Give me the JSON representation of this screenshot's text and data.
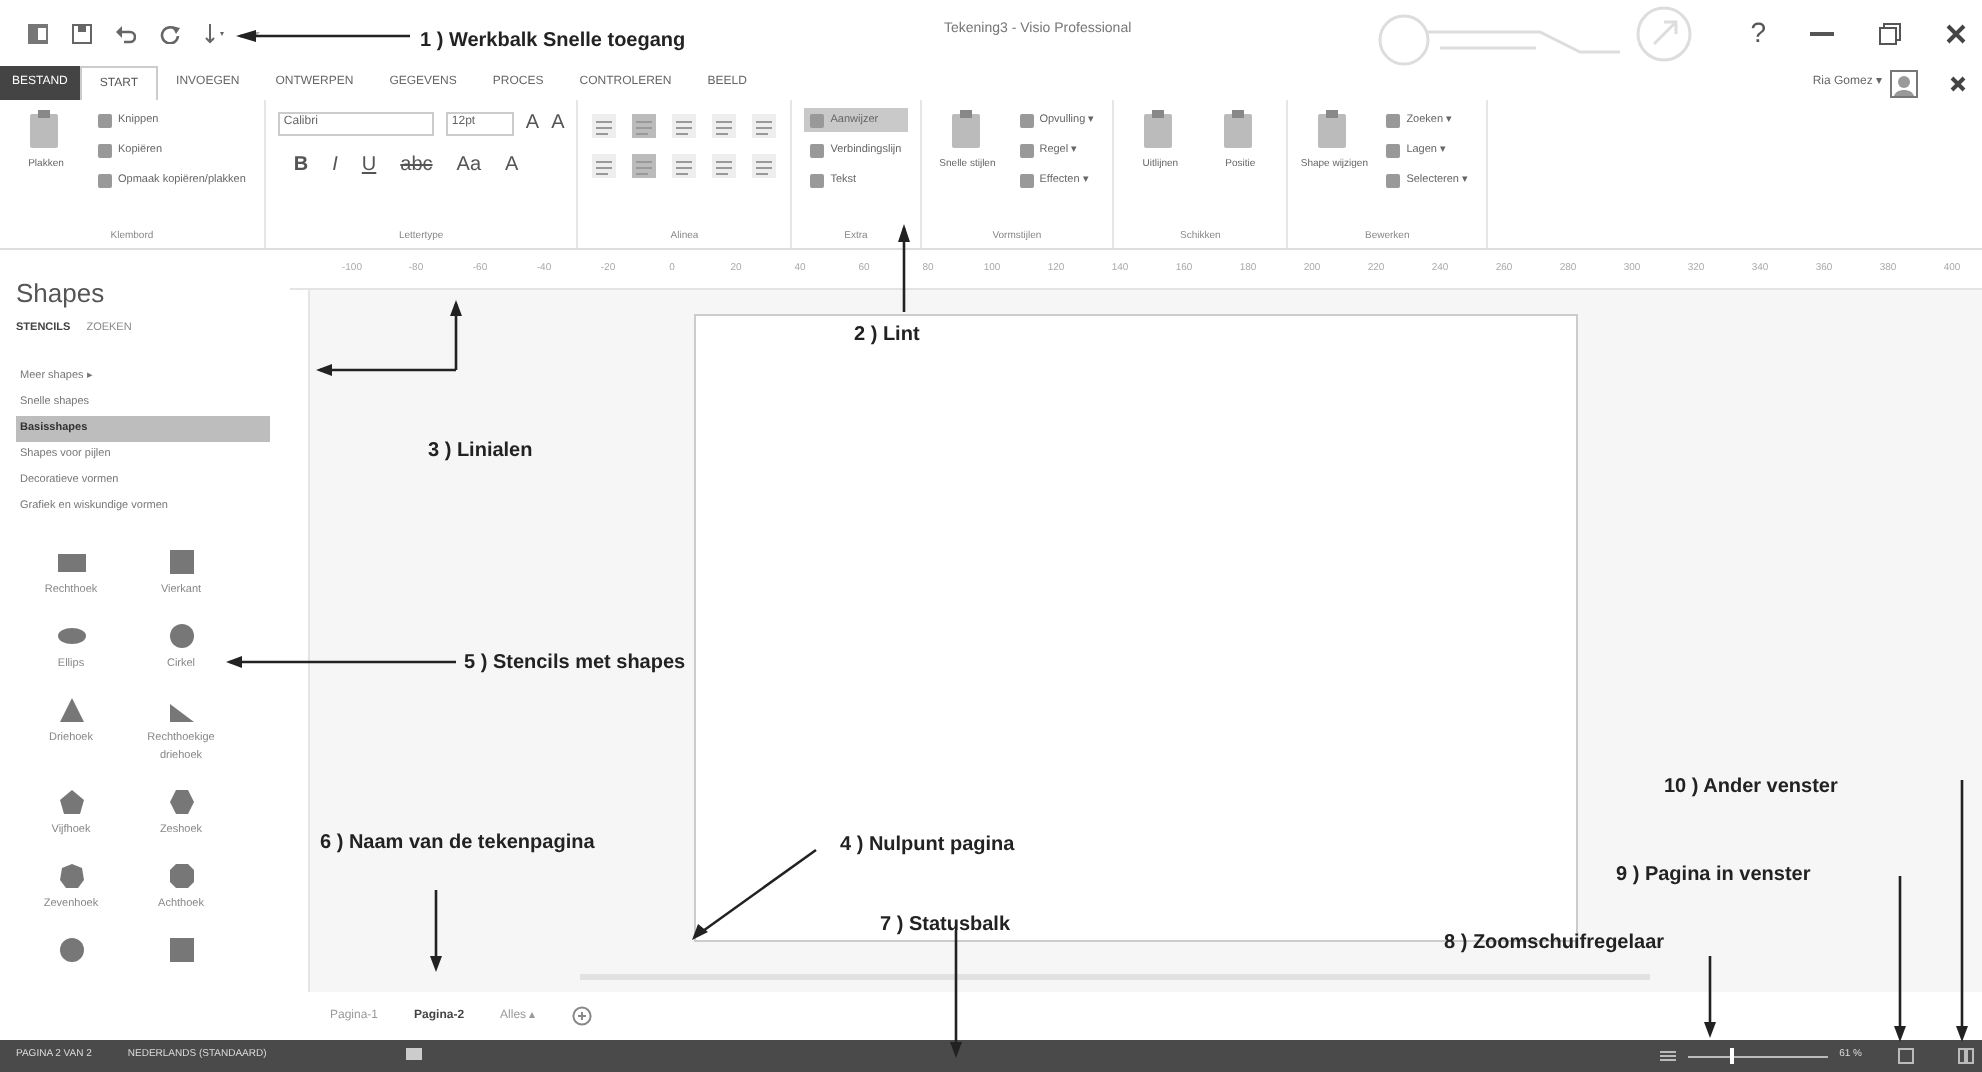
{
  "window": {
    "title": "Tekening3 - Visio Professional",
    "user": "Ria Gomez ▾",
    "help": "?"
  },
  "tabs": [
    {
      "label": "BESTAND",
      "kind": "file",
      "selected": false
    },
    {
      "label": "START",
      "kind": "tab",
      "selected": true
    },
    {
      "label": "INVOEGEN",
      "kind": "tab",
      "selected": false
    },
    {
      "label": "ONTWERPEN",
      "kind": "tab",
      "selected": false
    },
    {
      "label": "GEGEVENS",
      "kind": "tab",
      "selected": false
    },
    {
      "label": "PROCES",
      "kind": "tab",
      "selected": false
    },
    {
      "label": "CONTROLEREN",
      "kind": "tab",
      "selected": false
    },
    {
      "label": "BEELD",
      "kind": "tab",
      "selected": false
    }
  ],
  "ribbon": {
    "groups": [
      {
        "label": "Klembord",
        "large": [
          {
            "label": "Plakken"
          }
        ],
        "small": [
          {
            "label": "Knippen",
            "selected": false
          },
          {
            "label": "Kopiëren",
            "selected": false
          },
          {
            "label": "Opmaak kopiëren/plakken",
            "selected": false
          }
        ]
      },
      {
        "label": "Lettertype",
        "fields": [
          "Calibri",
          "12pt"
        ],
        "glyphs": [
          "A",
          "A",
          "B",
          "I",
          "U",
          "abc",
          "Aa",
          "A"
        ]
      },
      {
        "label": "Alinea",
        "buttons": [
          {
            "selected": false
          },
          {
            "selected": true
          },
          {
            "selected": false
          },
          {
            "selected": false
          },
          {
            "selected": false
          },
          {
            "selected": false
          },
          {
            "selected": true
          },
          {
            "selected": false
          },
          {
            "selected": false
          },
          {
            "selected": false
          }
        ]
      },
      {
        "label": "Extra",
        "small": [
          {
            "label": "Aanwijzer",
            "selected": true
          },
          {
            "label": "Verbindingslijn",
            "selected": false
          },
          {
            "label": "Tekst",
            "selected": false
          }
        ]
      },
      {
        "label": "Vormstijlen",
        "large": [
          {
            "label": "Snelle stijlen"
          }
        ],
        "small": [
          {
            "label": "Opvulling ▾",
            "selected": false
          },
          {
            "label": "Regel ▾",
            "selected": false
          },
          {
            "label": "Effecten ▾",
            "selected": false
          }
        ]
      },
      {
        "label": "Schikken",
        "large": [
          {
            "label": "Uitlijnen"
          },
          {
            "label": "Positie"
          }
        ]
      },
      {
        "label": "Bewerken",
        "large": [
          {
            "label": "Shape wijzigen"
          }
        ],
        "small": [
          {
            "label": "Zoeken ▾",
            "selected": false
          },
          {
            "label": "Lagen ▾",
            "selected": false
          },
          {
            "label": "Selecteren ▾",
            "selected": false
          }
        ]
      }
    ]
  },
  "ruler": [
    "-100",
    "-80",
    "-60",
    "-40",
    "-20",
    "0",
    "20",
    "40",
    "60",
    "80",
    "100",
    "120",
    "140",
    "160",
    "180",
    "200",
    "220",
    "240",
    "260",
    "280",
    "300",
    "320",
    "340",
    "360",
    "380",
    "400"
  ],
  "shapes_panel": {
    "title": "Shapes",
    "tabs": [
      {
        "label": "STENCILS",
        "selected": true
      },
      {
        "label": "ZOEKEN",
        "selected": false
      }
    ],
    "stencils": [
      {
        "label": "Meer shapes ▸",
        "selected": false
      },
      {
        "label": "Snelle shapes",
        "selected": false
      },
      {
        "label": "Basisshapes",
        "selected": true
      },
      {
        "label": "Shapes voor pijlen",
        "selected": false
      },
      {
        "label": "Decoratieve vormen",
        "selected": false
      },
      {
        "label": "Grafiek en wiskundige vormen",
        "selected": false
      }
    ],
    "shapes": [
      {
        "kind": "rectangle",
        "label": "Rechthoek"
      },
      {
        "kind": "square",
        "label": "Vierkant"
      },
      {
        "kind": "ellipse",
        "label": "Ellips"
      },
      {
        "kind": "circle",
        "label": "Cirkel"
      },
      {
        "kind": "triangle",
        "label": "Driehoek"
      },
      {
        "kind": "right-triangle",
        "label": "Rechthoekige driehoek"
      },
      {
        "kind": "pentagon",
        "label": "Vijfhoek"
      },
      {
        "kind": "hexagon",
        "label": "Zeshoek"
      },
      {
        "kind": "heptagon",
        "label": "Zevenhoek"
      },
      {
        "kind": "octagon",
        "label": "Achthoek"
      },
      {
        "kind": "circle"
      },
      {
        "kind": "square"
      }
    ]
  },
  "page_tabs": [
    {
      "label": "Pagina-1",
      "selected": false
    },
    {
      "label": "Pagina-2",
      "selected": true
    },
    {
      "label": "Alles ▴",
      "selected": false
    }
  ],
  "status_bar": {
    "page": "PAGINA 2 VAN 2",
    "language": "NEDERLANDS (STANDAARD)",
    "zoom": {
      "level": 0.3
    },
    "zoom_reading": "61 %"
  },
  "annotations": [
    {
      "label": "1 ) Werkbalk Snelle toegang"
    },
    {
      "label": "2 ) Lint"
    },
    {
      "label": "3 ) Linialen"
    },
    {
      "label": "5 ) Stencils met shapes"
    },
    {
      "label": "10 ) Ander venster"
    },
    {
      "label": "6 ) Naam van de tekenpagina"
    },
    {
      "label": "4 ) Nulpunt pagina"
    },
    {
      "label": "9 ) Pagina in venster"
    },
    {
      "label": "7 ) Statusbalk"
    },
    {
      "label": "8 ) Zoomschuifregelaar"
    }
  ]
}
